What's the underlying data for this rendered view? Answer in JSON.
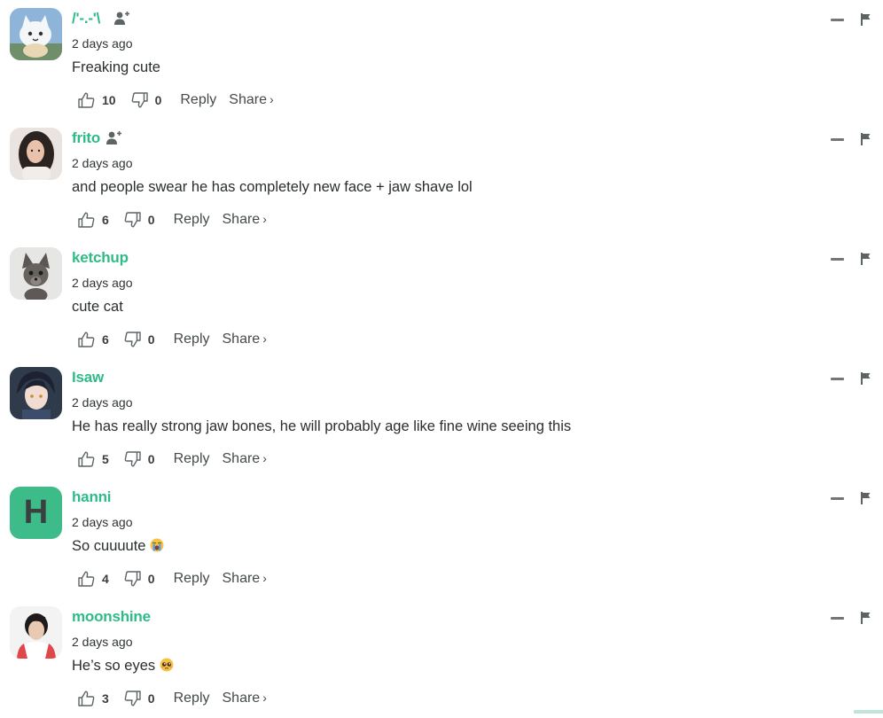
{
  "comments": [
    {
      "author": "/'-.-'\\",
      "show_follow": true,
      "time": "2 days ago",
      "text": "Freaking cute",
      "emoji": "",
      "avatar": "cartoon-cat-avatar",
      "likes": "10",
      "dislikes": "0",
      "reply_label": "Reply",
      "share_label": "Share",
      "share_chevron": "›"
    },
    {
      "author": "frito",
      "show_follow": true,
      "time": "2 days ago",
      "text": "and people swear he has completely new face + jaw shave lol",
      "emoji": "",
      "avatar": "photo-woman-avatar",
      "likes": "6",
      "dislikes": "0",
      "reply_label": "Reply",
      "share_label": "Share",
      "share_chevron": "›"
    },
    {
      "author": "ketchup",
      "show_follow": false,
      "time": "2 days ago",
      "text": "cute cat",
      "emoji": "",
      "avatar": "chihuahua-avatar",
      "likes": "6",
      "dislikes": "0",
      "reply_label": "Reply",
      "share_label": "Share",
      "share_chevron": "›"
    },
    {
      "author": "Isaw",
      "show_follow": false,
      "time": "2 days ago",
      "text": "He has really strong jaw bones, he will probably age like fine wine seeing this",
      "emoji": "",
      "avatar": "anime-man-avatar",
      "likes": "5",
      "dislikes": "0",
      "reply_label": "Reply",
      "share_label": "Share",
      "share_chevron": "›"
    },
    {
      "author": "hanni",
      "show_follow": false,
      "time": "2 days ago",
      "text": "So cuuuute",
      "emoji": "crying-face-emoji",
      "avatar": "letter-avatar",
      "avatar_letter": "H",
      "avatar_color": "#3dbc8a",
      "likes": "4",
      "dislikes": "0",
      "reply_label": "Reply",
      "share_label": "Share",
      "share_chevron": "›"
    },
    {
      "author": "moonshine",
      "show_follow": false,
      "time": "2 days ago",
      "text": "He’s so eyes",
      "emoji": "pleading-face-emoji",
      "avatar": "photo-man-avatar",
      "likes": "3",
      "dislikes": "0",
      "reply_label": "Reply",
      "share_label": "Share",
      "share_chevron": "›"
    }
  ],
  "colors": {
    "accent": "#2fbb87",
    "text": "#2a2e2e",
    "icon": "#70777a"
  }
}
